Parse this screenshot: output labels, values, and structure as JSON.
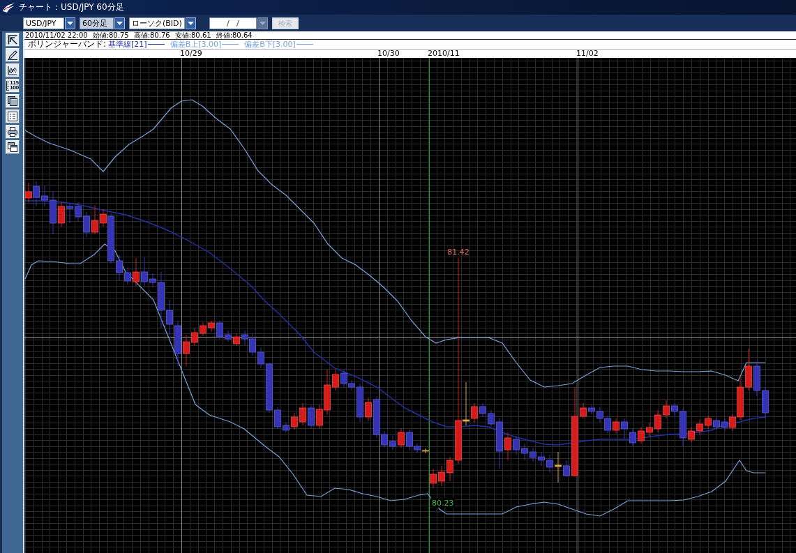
{
  "window": {
    "title": "チャート：USD/JPY 60分足"
  },
  "toolbar": {
    "selects": [
      {
        "value": "USD/JPY",
        "highlighted": false
      },
      {
        "value": "60分足",
        "highlighted": true
      },
      {
        "value": "ローソク(BID)",
        "highlighted": false
      }
    ],
    "date_field": {
      "value": "/   /",
      "dropdown_disabled": true
    },
    "search_button": {
      "label": "検索",
      "disabled": true
    }
  },
  "side_tools": [
    {
      "kind": "jump"
    },
    {
      "kind": "draw"
    },
    {
      "kind": "indicator"
    },
    {
      "kind": "scale",
      "lines": [
        "115",
        "100"
      ]
    },
    {
      "kind": "panel"
    },
    {
      "kind": "list"
    },
    {
      "kind": "print"
    },
    {
      "kind": "window"
    }
  ],
  "ohlc_bar": {
    "timestamp": "2010/11/02 22:00",
    "readings": [
      "始値:80.75",
      "高値:80.76",
      "安値:80.61",
      "終値:80.64"
    ]
  },
  "legend": {
    "title": "ボリンジャーバンド:",
    "items": [
      {
        "label": "基準線[21]",
        "color": "#2233a8"
      },
      {
        "label": "偏差B上[3.00]",
        "color": "#78a4dc"
      },
      {
        "label": "偏差B下[3.00]",
        "color": "#78a4dc"
      }
    ]
  },
  "date_axis": [
    {
      "text": "10/29",
      "kind": "day"
    },
    {
      "text": "10/30",
      "kind": "day"
    },
    {
      "text": "2010/11",
      "kind": "month"
    },
    {
      "text": "11/02",
      "kind": "day"
    }
  ],
  "chart": {
    "high_label": "81.42",
    "low_label": "80.23"
  }
}
